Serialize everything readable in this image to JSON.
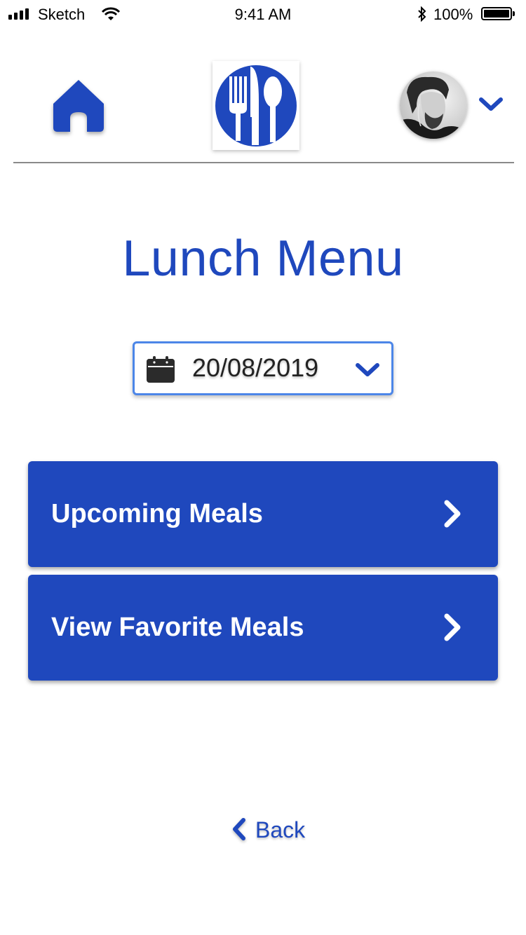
{
  "status_bar": {
    "carrier": "Sketch",
    "time": "9:41 AM",
    "battery_percent": "100%",
    "icons": [
      "signal-icon",
      "wifi-icon",
      "bluetooth-icon",
      "battery-icon"
    ]
  },
  "header": {
    "home_icon": "home-icon",
    "logo_icon": "fork-knife-spoon-icon",
    "profile_icon": "avatar",
    "profile_menu_icon": "chevron-down-icon"
  },
  "page": {
    "title": "Lunch Menu"
  },
  "date_select": {
    "value": "20/08/2019",
    "icon": "calendar-icon",
    "dropdown_icon": "chevron-down-icon"
  },
  "actions": {
    "upcoming_label": "Upcoming Meals",
    "favorites_label": "View Favorite Meals",
    "arrow_icon": "chevron-right-icon"
  },
  "footer": {
    "back_label": "Back",
    "back_icon": "chevron-left-icon"
  },
  "colors": {
    "primary": "#1f48bd",
    "select_border": "#4c86e8",
    "divider": "#8a8a8a"
  }
}
